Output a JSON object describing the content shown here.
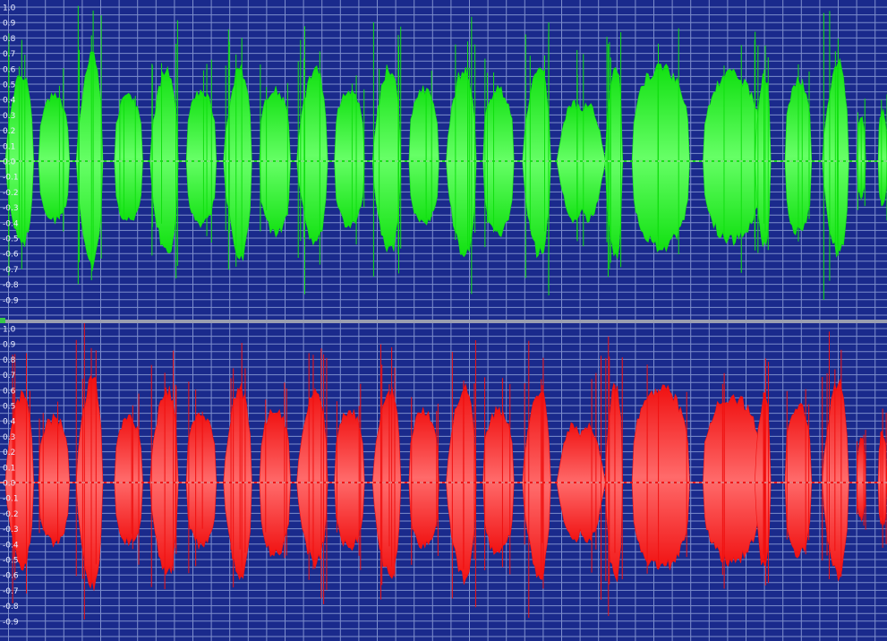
{
  "colors": {
    "background": "#1a2a8c",
    "grid": "#8fa0d8",
    "zero_line": "#e0e0e0",
    "divider": "#9a9eb0",
    "label": "#e8ecff"
  },
  "amplitude_scale": {
    "min": -1.0,
    "max": 1.0,
    "step": 0.1,
    "shown_labels_left": true
  },
  "channels": [
    {
      "id": "left",
      "name": "",
      "waveform_color": "#10e010",
      "waveform_highlight": "#66ff66",
      "labels": [
        "1.0",
        "0.9",
        "0.8",
        "0.7",
        "0.6",
        "0.5",
        "0.4",
        "0.3",
        "0.2",
        "0.1",
        "0.0",
        "-0.1",
        "-0.2",
        "-0.3",
        "-0.4",
        "-0.5",
        "-0.6",
        "-0.7",
        "-0.8",
        "-0.9"
      ]
    },
    {
      "id": "right",
      "name": "",
      "waveform_color": "#f01010",
      "waveform_highlight": "#ff6a6a",
      "labels": [
        "1.0",
        "0.9",
        "0.8",
        "0.7",
        "0.6",
        "0.5",
        "0.4",
        "0.3",
        "0.2",
        "0.1",
        "0.0",
        "-0.1",
        "-0.2",
        "-0.3",
        "-0.4",
        "-0.5",
        "-0.6",
        "-0.7",
        "-0.8",
        "-0.9"
      ]
    }
  ],
  "bursts": [
    {
      "center": 0.022,
      "width": 0.032,
      "upper": 0.75,
      "lower": 0.72,
      "shape": "tall"
    },
    {
      "center": 0.061,
      "width": 0.035,
      "upper": 0.45,
      "lower": 0.42,
      "shape": "flat"
    },
    {
      "center": 0.101,
      "width": 0.03,
      "upper": 0.9,
      "lower": 0.9,
      "shape": "tall"
    },
    {
      "center": 0.145,
      "width": 0.032,
      "upper": 0.45,
      "lower": 0.42,
      "shape": "flat"
    },
    {
      "center": 0.185,
      "width": 0.032,
      "upper": 0.8,
      "lower": 0.8,
      "shape": "tall"
    },
    {
      "center": 0.227,
      "width": 0.034,
      "upper": 0.48,
      "lower": 0.44,
      "shape": "flat"
    },
    {
      "center": 0.268,
      "width": 0.032,
      "upper": 0.8,
      "lower": 0.82,
      "shape": "tall"
    },
    {
      "center": 0.31,
      "width": 0.035,
      "upper": 0.5,
      "lower": 0.5,
      "shape": "flat"
    },
    {
      "center": 0.352,
      "width": 0.035,
      "upper": 0.8,
      "lower": 0.7,
      "shape": "tall"
    },
    {
      "center": 0.394,
      "width": 0.034,
      "upper": 0.5,
      "lower": 0.45,
      "shape": "flat"
    },
    {
      "center": 0.436,
      "width": 0.032,
      "upper": 0.8,
      "lower": 0.8,
      "shape": "tall"
    },
    {
      "center": 0.478,
      "width": 0.034,
      "upper": 0.5,
      "lower": 0.44,
      "shape": "flat"
    },
    {
      "center": 0.52,
      "width": 0.034,
      "upper": 0.8,
      "lower": 0.82,
      "shape": "tall"
    },
    {
      "center": 0.562,
      "width": 0.035,
      "upper": 0.5,
      "lower": 0.5,
      "shape": "flat"
    },
    {
      "center": 0.605,
      "width": 0.032,
      "upper": 0.8,
      "lower": 0.8,
      "shape": "tall"
    },
    {
      "center": 0.655,
      "width": 0.055,
      "upper": 0.6,
      "lower": 0.6,
      "shape": "pinch"
    },
    {
      "center": 0.692,
      "width": 0.02,
      "upper": 0.85,
      "lower": 0.85,
      "shape": "tall"
    },
    {
      "center": 0.745,
      "width": 0.065,
      "upper": 0.65,
      "lower": 0.6,
      "shape": "flat"
    },
    {
      "center": 0.825,
      "width": 0.065,
      "upper": 0.6,
      "lower": 0.55,
      "shape": "flat"
    },
    {
      "center": 0.86,
      "width": 0.018,
      "upper": 0.75,
      "lower": 0.75,
      "shape": "tall"
    },
    {
      "center": 0.9,
      "width": 0.03,
      "upper": 0.55,
      "lower": 0.5,
      "shape": "flat"
    },
    {
      "center": 0.942,
      "width": 0.03,
      "upper": 0.85,
      "lower": 0.8,
      "shape": "tall"
    },
    {
      "center": 0.971,
      "width": 0.01,
      "upper": 0.3,
      "lower": 0.25,
      "shape": "flat"
    },
    {
      "center": 0.995,
      "width": 0.01,
      "upper": 0.35,
      "lower": 0.3,
      "shape": "flat"
    }
  ]
}
